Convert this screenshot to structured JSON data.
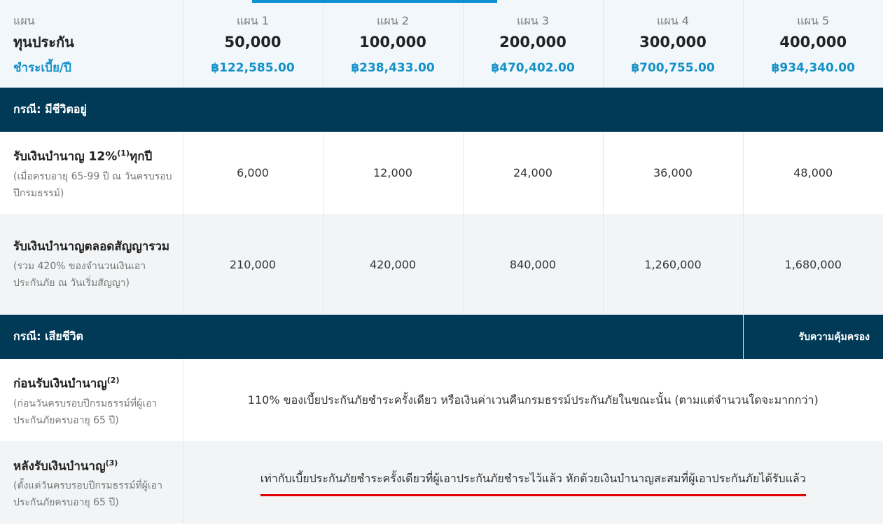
{
  "header": {
    "plan_label": "แผน",
    "sum_label": "ทุนประกัน",
    "premium_label": "ชำระเบี้ย/ปี",
    "plans": [
      {
        "name": "แผน 1",
        "sum": "50,000",
        "premium": "฿122,585.00"
      },
      {
        "name": "แผน 2",
        "sum": "100,000",
        "premium": "฿238,433.00"
      },
      {
        "name": "แผน 3",
        "sum": "200,000",
        "premium": "฿470,402.00"
      },
      {
        "name": "แผน 4",
        "sum": "300,000",
        "premium": "฿700,755.00"
      },
      {
        "name": "แผน 5",
        "sum": "400,000",
        "premium": "฿934,340.00"
      }
    ]
  },
  "alive": {
    "title": "กรณี: มีชีวิตอยู่",
    "rows": [
      {
        "title": "รับเงินบำนาญ 12%",
        "sup": "(1)",
        "title_suffix": "ทุกปี",
        "sub": "(เมื่อครบอายุ 65-99 ปี ณ วันครบรอบปีกรมธรรม์)",
        "values": [
          "6,000",
          "12,000",
          "24,000",
          "36,000",
          "48,000"
        ]
      },
      {
        "title": "รับเงินบำนาญตลอดสัญญารวม",
        "sub": "(รวม 420% ของจำนวนเงินเอาประกันภัย ณ วันเริ่มสัญญา)",
        "values": [
          "210,000",
          "420,000",
          "840,000",
          "1,260,000",
          "1,680,000"
        ]
      }
    ]
  },
  "death": {
    "title": "กรณี: เสียชีวิต",
    "right_label": "รับความคุ้มครอง",
    "rows": [
      {
        "title": "ก่อนรับเงินบำนาญ",
        "sup": "(2)",
        "sub": "(ก่อนวันครบรอบปีกรมธรรม์ที่ผู้เอาประกันภัยครบอายุ 65 ปี)",
        "text": "110% ของเบี้ยประกันภัยชำระครั้งเดียว หรือเงินค่าเวนคืนกรมธรรม์ประกันภัยในขณะนั้น (ตามแต่จำนวนใดจะมากกว่า)"
      },
      {
        "title": "หลังรับเงินบำนาญ",
        "sup": "(3)",
        "sub": "(ตั้งแต่วันครบรอบปีกรมธรรม์ที่ผู้เอาประกันภัยครบอายุ 65 ปี)",
        "text": "เท่ากับเบี้ยประกันภัยชำระครั้งเดียวที่ผู้เอาประกันภัยชำระไว้แล้ว หักด้วยเงินบำนาญสะสมที่ผู้เอาประกันภัยได้รับแล้ว"
      }
    ]
  },
  "colors": {
    "accent": "#1591c8",
    "section": "#003a57",
    "highlight": "#e00000"
  }
}
